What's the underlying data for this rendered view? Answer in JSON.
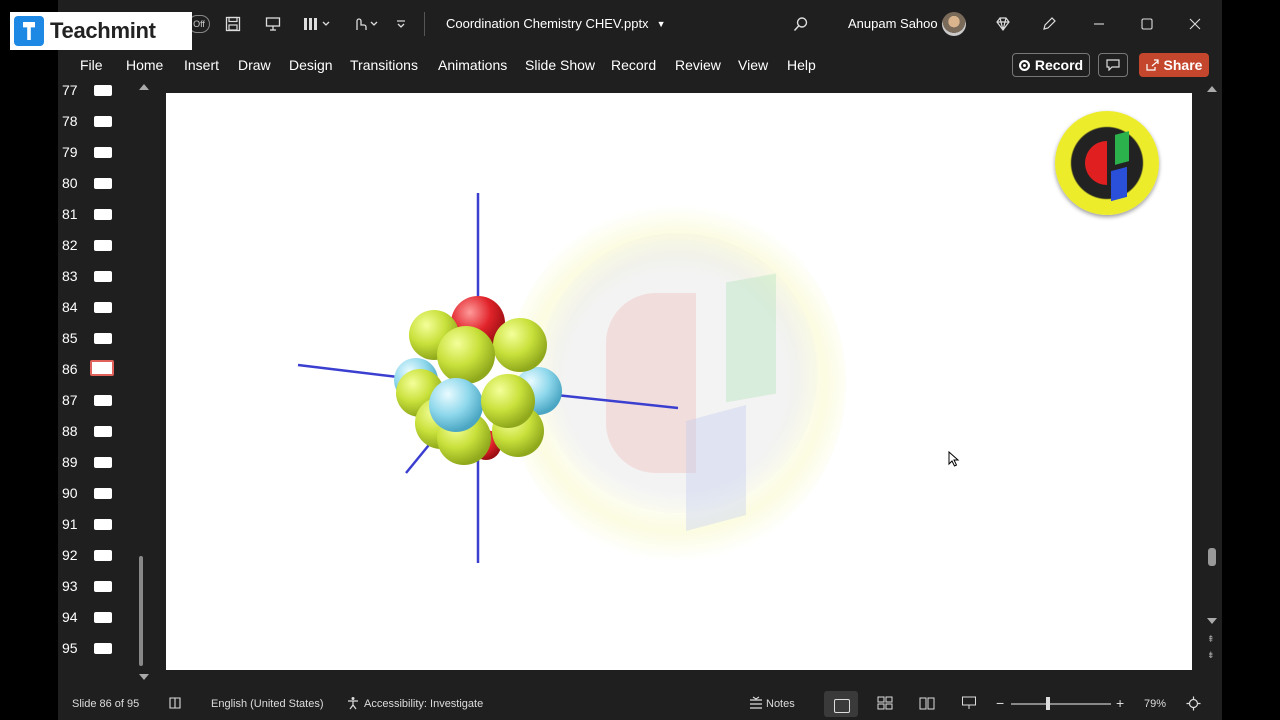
{
  "brand": {
    "name": "Teachmint"
  },
  "titlebar": {
    "autosave_toggle": "Off",
    "doc_title": "Coordination Chemistry CHEV.pptx",
    "user_name": "Anupam Sahoo"
  },
  "ribbon": {
    "tabs": [
      "File",
      "Home",
      "Insert",
      "Draw",
      "Design",
      "Transitions",
      "Animations",
      "Slide Show",
      "Record",
      "Review",
      "View",
      "Help"
    ],
    "record_label": "Record",
    "share_label": "Share"
  },
  "thumbnails": {
    "numbers": [
      "77",
      "78",
      "79",
      "80",
      "81",
      "82",
      "83",
      "84",
      "85",
      "86",
      "87",
      "88",
      "89",
      "90",
      "91",
      "92",
      "93",
      "94",
      "95"
    ],
    "active": "86"
  },
  "statusbar": {
    "slide_info": "Slide 86 of 95",
    "language": "English (United States)",
    "accessibility": "Accessibility: Investigate",
    "notes_label": "Notes",
    "zoom": "79%"
  },
  "colors": {
    "share": "#c4462c",
    "ligand_yellow": "#c8e03a",
    "ligand_cyan": "#8fd8ec",
    "ligand_red": "#e0232a",
    "axis": "#3b3fd0"
  }
}
